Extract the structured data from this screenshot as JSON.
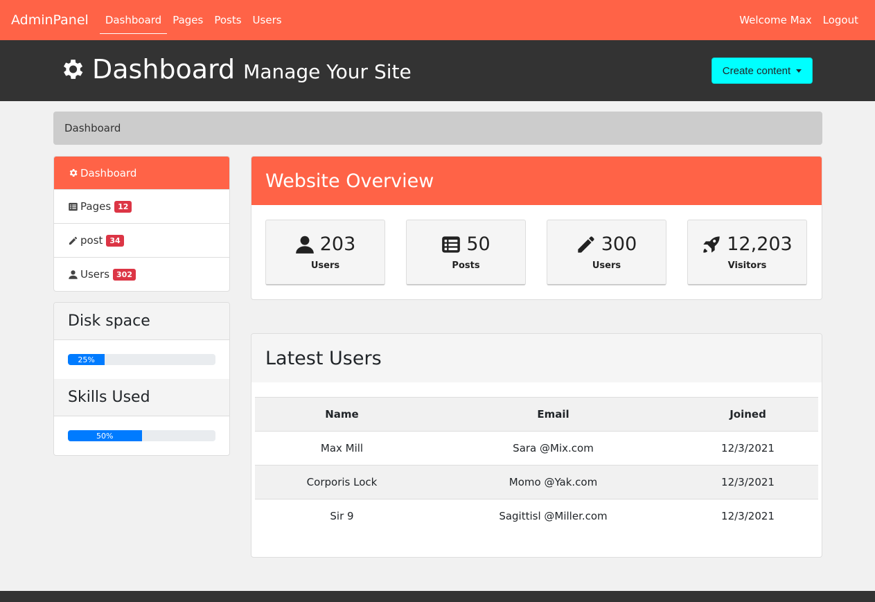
{
  "nav": {
    "brand": "AdminPanel",
    "links": [
      "Dashboard",
      "Pages",
      "Posts",
      "Users"
    ],
    "welcome": "Welcome Max",
    "logout": "Logout"
  },
  "header": {
    "title": "Dashboard",
    "subtitle": "Manage Your Site",
    "create_button": "Create content"
  },
  "breadcrumb": "Dashboard",
  "sidebar": {
    "items": [
      {
        "label": "Dashboard",
        "icon": "gear-icon"
      },
      {
        "label": "Pages",
        "badge": "12",
        "icon": "list-icon"
      },
      {
        "label": "post",
        "badge": "34",
        "icon": "pencil-icon"
      },
      {
        "label": "Users",
        "badge": "302",
        "icon": "user-icon"
      }
    ]
  },
  "progress": {
    "disk": {
      "title": "Disk space",
      "value": "25%",
      "fraction": 0.25
    },
    "skills": {
      "title": "Skills Used",
      "value": "50%",
      "fraction": 0.5
    }
  },
  "overview": {
    "title": "Website Overview",
    "stats": [
      {
        "value": "203",
        "label": "Users",
        "icon": "user-icon"
      },
      {
        "value": "50",
        "label": "Posts",
        "icon": "list-icon"
      },
      {
        "value": "300",
        "label": "Users",
        "icon": "pencil-icon"
      },
      {
        "value": "12,203",
        "label": "Visitors",
        "icon": "rocket-icon"
      }
    ]
  },
  "latest_users": {
    "title": "Latest Users",
    "columns": [
      "Name",
      "Email",
      "Joined"
    ],
    "rows": [
      [
        "Max Mill",
        "Sara @Mix.com",
        "12/3/2021"
      ],
      [
        "Corporis Lock",
        "Momo @Yak.com",
        "12/3/2021"
      ],
      [
        "Sir 9",
        "Sagittisl @Miller.com",
        "12/3/2021"
      ]
    ]
  },
  "colors": {
    "accent": "#ff6347",
    "dark": "#333333",
    "button": "#00ffff",
    "badge": "#dc3545",
    "progress": "#007bff"
  }
}
